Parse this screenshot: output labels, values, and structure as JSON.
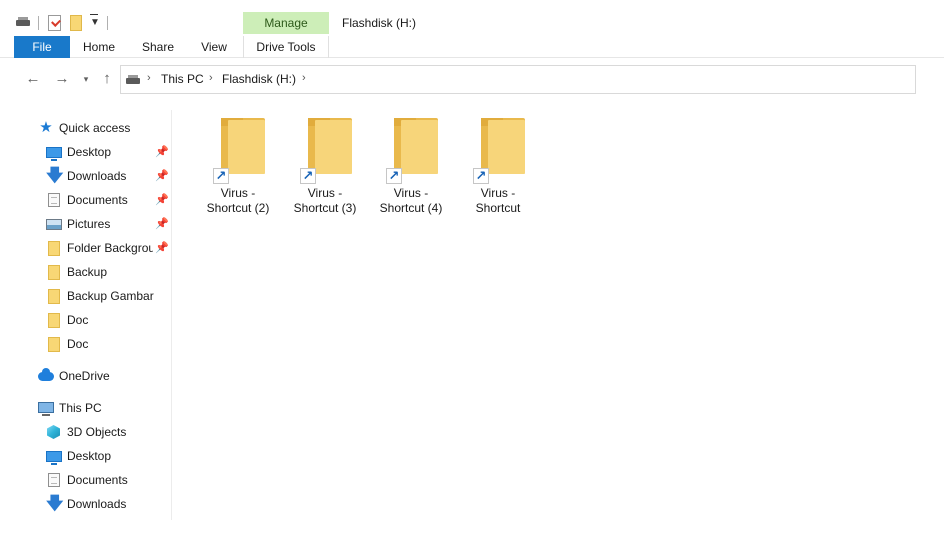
{
  "qat": {
    "icons": [
      "drive-icon",
      "properties-icon",
      "new-folder-icon",
      "customize-dropdown-icon"
    ]
  },
  "context_tab": {
    "group_label": "Manage",
    "label": "Drive Tools",
    "color": "#cdeeb8"
  },
  "window": {
    "title": "Flashdisk (H:)"
  },
  "ribbon": {
    "tabs": [
      "File",
      "Home",
      "Share",
      "View"
    ],
    "file_color": "#1979ca"
  },
  "address": {
    "crumbs": [
      "This PC",
      "Flashdisk (H:)"
    ]
  },
  "nav": {
    "quick_access": "Quick access",
    "items": [
      {
        "label": "Desktop",
        "icon": "desktop-icon",
        "pinned": true
      },
      {
        "label": "Downloads",
        "icon": "download-arrow-icon",
        "pinned": true
      },
      {
        "label": "Documents",
        "icon": "documents-icon",
        "pinned": true
      },
      {
        "label": "Pictures",
        "icon": "pictures-icon",
        "pinned": true
      },
      {
        "label": "Folder Backgrou",
        "icon": "folder-icon",
        "pinned": true
      },
      {
        "label": "Backup",
        "icon": "folder-icon",
        "pinned": false
      },
      {
        "label": "Backup Gambar",
        "icon": "folder-icon",
        "pinned": false
      },
      {
        "label": "Doc",
        "icon": "folder-icon",
        "pinned": false
      },
      {
        "label": "Doc",
        "icon": "folder-icon",
        "pinned": false
      }
    ],
    "onedrive": "OneDrive",
    "this_pc": "This PC",
    "pc_items": [
      {
        "label": "3D Objects",
        "icon": "3d-objects-icon"
      },
      {
        "label": "Desktop",
        "icon": "desktop-icon"
      },
      {
        "label": "Documents",
        "icon": "documents-icon"
      },
      {
        "label": "Downloads",
        "icon": "download-arrow-icon"
      }
    ]
  },
  "files": [
    {
      "line1": "Virus -",
      "line2": "Shortcut (2)"
    },
    {
      "line1": "Virus -",
      "line2": "Shortcut (3)"
    },
    {
      "line1": "Virus -",
      "line2": "Shortcut (4)"
    },
    {
      "line1": "Virus -",
      "line2": "Shortcut"
    }
  ]
}
